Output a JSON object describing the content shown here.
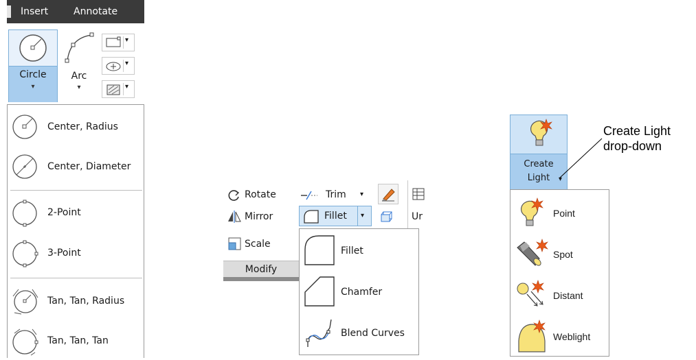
{
  "draw_panel": {
    "tabs": [
      {
        "label": "Insert"
      },
      {
        "label": "Annotate"
      }
    ],
    "circle_button": {
      "label": "Circle",
      "caret": "▾"
    },
    "arc_button": {
      "label": "Arc",
      "caret": "▾"
    },
    "small_tool_carets": [
      "▾",
      "▾",
      "▾"
    ],
    "circle_menu": [
      {
        "label": "Center, Radius",
        "icon": "circle-center-radius-icon"
      },
      {
        "label": "Center, Diameter",
        "icon": "circle-center-diameter-icon"
      },
      {
        "label": "2-Point",
        "icon": "circle-2point-icon"
      },
      {
        "label": "3-Point",
        "icon": "circle-3point-icon"
      },
      {
        "label": "Tan, Tan, Radius",
        "icon": "circle-ttr-icon"
      },
      {
        "label": "Tan, Tan, Tan",
        "icon": "circle-ttt-icon"
      }
    ]
  },
  "modify_panel": {
    "rotate_label": "Rotate",
    "mirror_label": "Mirror",
    "scale_label": "Scale",
    "trim_label": "Trim",
    "trim_caret": "▾",
    "fillet_label": "Fillet",
    "fillet_caret": "▾",
    "partial_label": "Ur",
    "panel_title": "Modify",
    "fillet_menu": [
      {
        "label": "Fillet",
        "icon": "fillet-icon"
      },
      {
        "label": "Chamfer",
        "icon": "chamfer-icon"
      },
      {
        "label": "Blend Curves",
        "icon": "blend-curves-icon"
      }
    ]
  },
  "light_panel": {
    "button_label_line1": "Create",
    "button_label_line2": "Light",
    "caret": "▾",
    "light_menu": [
      {
        "label": "Point",
        "icon": "point-light-icon"
      },
      {
        "label": "Spot",
        "icon": "spot-light-icon"
      },
      {
        "label": "Distant",
        "icon": "distant-light-icon"
      },
      {
        "label": "Weblight",
        "icon": "weblight-icon"
      }
    ],
    "callout_line1": "Create Light",
    "callout_line2": "drop-down"
  },
  "colors": {
    "highlight": "#a8cdee",
    "highlight_light": "#e8f1fb",
    "tab_bar": "#3a3a3a",
    "bulb_yellow": "#f7e27a",
    "spark_orange": "#e85a1a"
  }
}
